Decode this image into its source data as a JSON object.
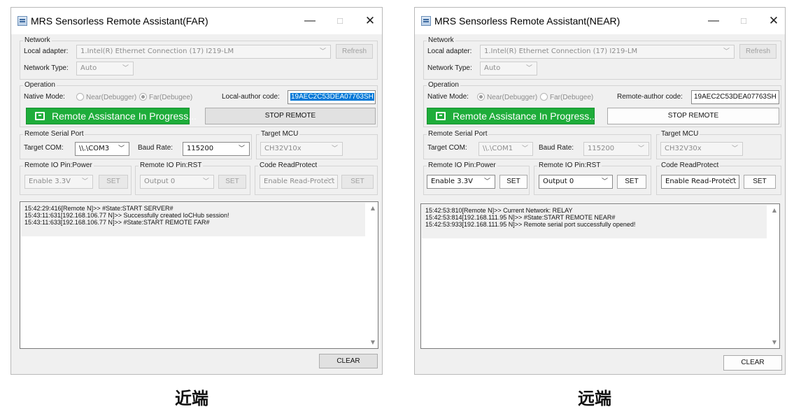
{
  "far": {
    "title": "MRS Sensorless Remote Assistant(FAR)",
    "network": {
      "group_label": "Network",
      "adapter_label": "Local adapter:",
      "adapter_value": "1.Intel(R) Ethernet Connection (17) I219-LM",
      "refresh_label": "Refresh",
      "type_label": "Network Type:",
      "type_value": "Auto"
    },
    "operation": {
      "group_label": "Operation",
      "mode_label": "Native Mode:",
      "radio_near": "Near(Debugger)",
      "radio_far": "Far(Debugee)",
      "selected_mode": "far",
      "code_label": "Local-author code:",
      "code_value": "19AEC2C53DEA07763SH",
      "assist_label": "Remote Assistance In Progress...",
      "stop_label": "STOP REMOTE"
    },
    "serial": {
      "group_label": "Remote Serial Port",
      "com_label": "Target COM:",
      "com_value": "\\\\.\\COM3",
      "baud_label": "Baud Rate:",
      "baud_value": "115200"
    },
    "mcu": {
      "group_label": "Target MCU",
      "value": "CH32V10x"
    },
    "power": {
      "group_label": "Remote IO Pin:Power",
      "value": "Enable 3.3V",
      "set_label": "SET"
    },
    "rst": {
      "group_label": "Remote IO Pin:RST",
      "value": "Output 0",
      "set_label": "SET"
    },
    "protect": {
      "group_label": "Code ReadProtect",
      "value": "Enable Read-Protect",
      "set_label": "SET"
    },
    "log": [
      "15:42:29:416[Remote N]>> #State:START SERVER#",
      "15:43:11:631[192.168.106.77 N]>> Successfully created IoCHub session!",
      "15:43:11:633[192.168.106.77 N]>> #State:START REMOTE FAR#"
    ],
    "clear_label": "CLEAR",
    "caption": "近端"
  },
  "near": {
    "title": "MRS Sensorless Remote Assistant(NEAR)",
    "network": {
      "group_label": "Network",
      "adapter_label": "Local adapter:",
      "adapter_value": "1.Intel(R) Ethernet Connection (17) I219-LM",
      "refresh_label": "Refresh",
      "type_label": "Network Type:",
      "type_value": "Auto"
    },
    "operation": {
      "group_label": "Operation",
      "mode_label": "Native Mode:",
      "radio_near": "Near(Debugger)",
      "radio_far": "Far(Debugee)",
      "selected_mode": "near",
      "code_label": "Remote-author code:",
      "code_value": "19AEC2C53DEA07763SH",
      "assist_label": "Remote Assistance In Progress...",
      "stop_label": "STOP REMOTE"
    },
    "serial": {
      "group_label": "Remote Serial Port",
      "com_label": "Target COM:",
      "com_value": "\\\\.\\COM1",
      "baud_label": "Baud Rate:",
      "baud_value": "115200"
    },
    "mcu": {
      "group_label": "Target MCU",
      "value": "CH32V30x"
    },
    "power": {
      "group_label": "Remote IO Pin:Power",
      "value": "Enable 3.3V",
      "set_label": "SET"
    },
    "rst": {
      "group_label": "Remote IO Pin:RST",
      "value": "Output 0",
      "set_label": "SET"
    },
    "protect": {
      "group_label": "Code ReadProtect",
      "value": "Enable Read-Protect",
      "set_label": "SET"
    },
    "log": [
      "15:42:53:810[Remote N]>> Current Network: RELAY",
      "15:42:53:814[192.168.111.95 N]>> #State:START REMOTE NEAR#",
      "15:42:53:933[192.168.111.95 N]>> Remote serial port successfully opened!"
    ],
    "clear_label": "CLEAR",
    "caption": "远端"
  },
  "icons": {
    "minimize": "—",
    "maximize": "□",
    "close": "✕",
    "chevron": "﹀",
    "scroll_up": "▲",
    "scroll_down": "▼"
  }
}
